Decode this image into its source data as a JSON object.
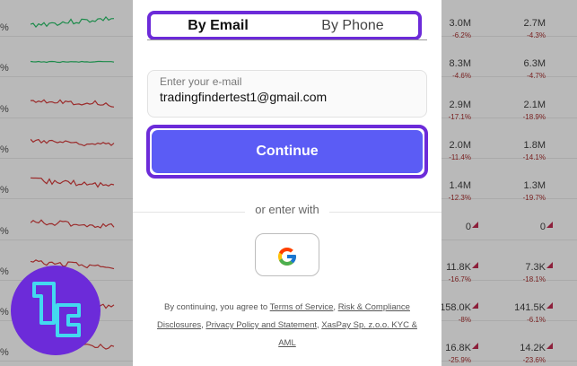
{
  "background": {
    "rows": [
      {
        "pct": "%",
        "spark_color": "#1d8b4b",
        "v1": "3.0M",
        "c1": "-6.2%",
        "v2": "2.7M",
        "c2": "-4.3%"
      },
      {
        "pct": "%",
        "spark_color": "#1d8b4b",
        "v1": "8.3M",
        "c1": "-4.6%",
        "v2": "6.3M",
        "c2": "-4.7%"
      },
      {
        "pct": "%",
        "spark_color": "#9b2b2b",
        "v1": "2.9M",
        "c1": "-17.1%",
        "v2": "2.1M",
        "c2": "-18.9%"
      },
      {
        "pct": "%",
        "spark_color": "#9b2b2b",
        "v1": "2.0M",
        "c1": "-11.4%",
        "v2": "1.8M",
        "c2": "-14.1%"
      },
      {
        "pct": "%",
        "spark_color": "#9b2b2b",
        "v1": "1.4M",
        "c1": "-12.3%",
        "v2": "1.3M",
        "c2": "-19.7%"
      },
      {
        "pct": "%",
        "spark_color": "#9b2b2b",
        "v1": "0",
        "c1": "",
        "v2": "0",
        "c2": ""
      },
      {
        "pct": "%",
        "spark_color": "#9b2b2b",
        "v1": "11.8K",
        "c1": "-16.7%",
        "v2": "7.3K",
        "c2": "-18.1%"
      },
      {
        "pct": "%",
        "spark_color": "#9b2b2b",
        "v1": "158.0K",
        "c1": "-8%",
        "v2": "141.5K",
        "c2": "-6.1%"
      },
      {
        "pct": "%",
        "spark_color": "#9b2b2b",
        "v1": "16.8K",
        "c1": "-25.9%",
        "v2": "14.2K",
        "c2": "-23.6%"
      }
    ]
  },
  "modal": {
    "tabs": {
      "email": "By Email",
      "phone": "By Phone",
      "active": "email"
    },
    "email_field": {
      "label": "Enter your e-mail",
      "value": "tradingfindertest1@gmail.com"
    },
    "continue_label": "Continue",
    "or_text": "or enter with",
    "google_icon": "google-icon",
    "legal": {
      "prefix": "By continuing, you agree to ",
      "tos": "Terms of Service",
      "sep1": ", ",
      "risk": "Risk & Compliance Disclosures",
      "sep2": ", ",
      "privacy": "Privacy Policy and Statement",
      "sep3": ", ",
      "kyc": "XasPay Sp. z.o.o. KYC & AML"
    }
  },
  "colors": {
    "accent_border": "#6c2bd9",
    "continue_bg": "#5b5cf5"
  }
}
